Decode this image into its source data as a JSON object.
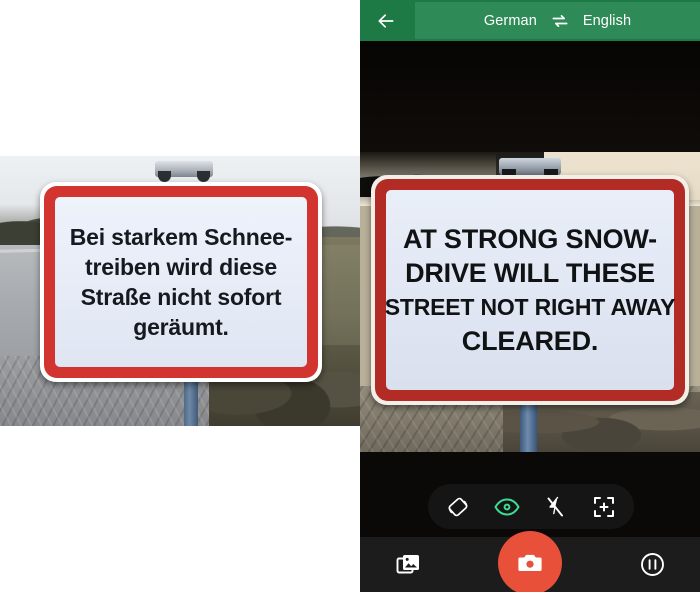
{
  "app": {
    "name": "translate-camera",
    "accent_green": "#2e8b57",
    "appbar_green_dark": "#1d7a45",
    "shutter_color": "#e8503a",
    "eye_active_color": "#3ddc91"
  },
  "appbar": {
    "back_icon": "back-arrow-icon",
    "source_language": "German",
    "swap_icon": "swap-languages-icon",
    "target_language": "English"
  },
  "original_photo": {
    "caption": "photo of a German road sign",
    "sign_lines": [
      "Bei starkem Schnee-",
      "treiben wird diese",
      "Straße nicht sofort",
      "geräumt."
    ]
  },
  "viewfinder": {
    "caption": "live camera view with translated sign overlay",
    "sign_lines": [
      "AT STRONG SNOW-",
      "DRIVE WILL THESE",
      "STREET NOT RIGHT AWAY",
      "CLEARED."
    ]
  },
  "pill_toolbar": {
    "buttons": [
      {
        "icon": "screen-rotation-icon",
        "label": "Rotate",
        "active": false
      },
      {
        "icon": "eye-icon",
        "label": "Instant translate",
        "active": true
      },
      {
        "icon": "flash-off-icon",
        "label": "Flash off",
        "active": false
      },
      {
        "icon": "scan-crop-icon",
        "label": "Scan",
        "active": false
      }
    ]
  },
  "bottom_bar": {
    "gallery_icon": "gallery-icon",
    "gallery_label": "Import",
    "shutter_icon": "camera-icon",
    "shutter_label": "Scan",
    "pause_icon": "pause-circle-icon",
    "pause_label": "Pause"
  }
}
